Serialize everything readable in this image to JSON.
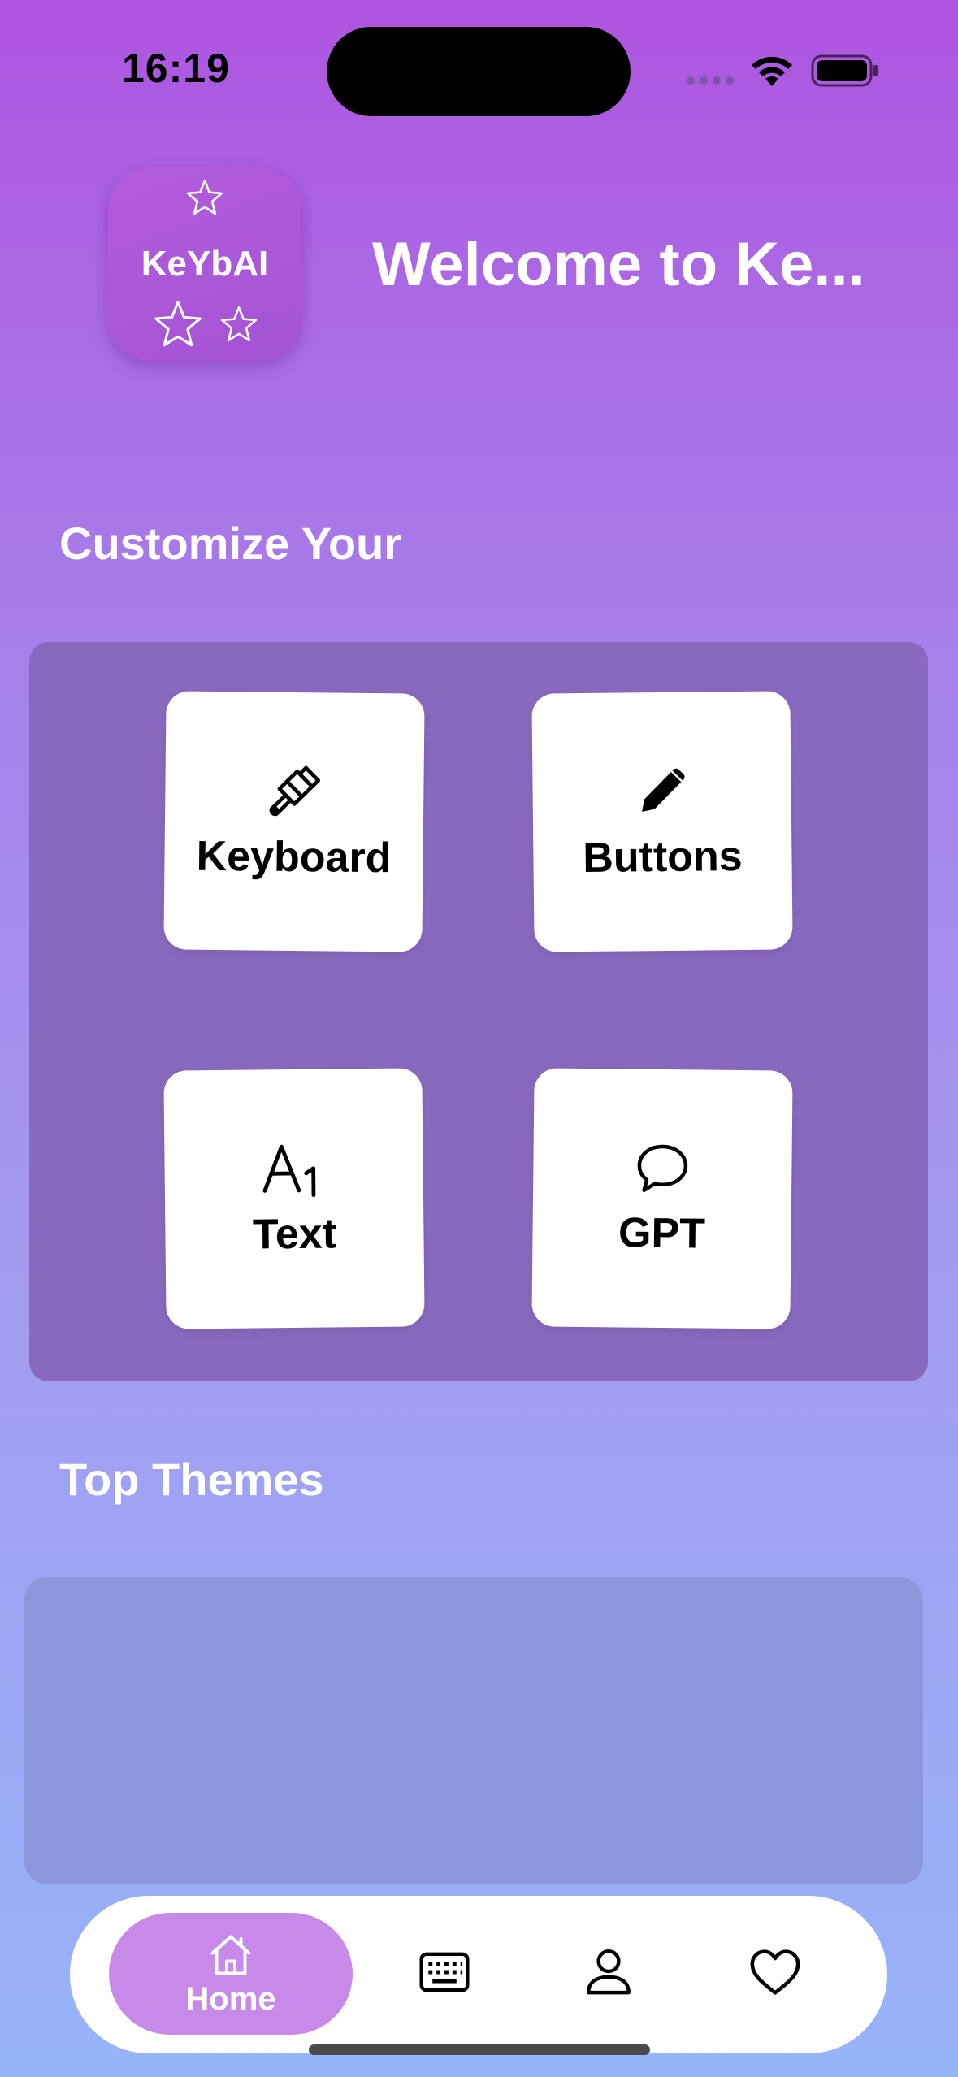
{
  "status_bar": {
    "time": "16:19"
  },
  "header": {
    "logo_text": "KeYbAI",
    "welcome": "Welcome to Ke..."
  },
  "customize": {
    "title": "Customize Your",
    "cards": [
      {
        "label": "Keyboard",
        "icon": "paintbrush-icon"
      },
      {
        "label": "Buttons",
        "icon": "pencil-icon"
      },
      {
        "label": "Text",
        "icon": "text-format-icon"
      },
      {
        "label": "GPT",
        "icon": "chat-bubble-icon"
      }
    ]
  },
  "themes": {
    "title": "Top Themes"
  },
  "tab_bar": {
    "items": [
      {
        "label": "Home",
        "icon": "house-icon",
        "selected": true
      },
      {
        "label": "",
        "icon": "keyboard-icon"
      },
      {
        "label": "",
        "icon": "person-icon"
      },
      {
        "label": "",
        "icon": "heart-icon"
      }
    ]
  },
  "colors": {
    "gradient_top": "#AE55E0",
    "gradient_bottom": "#97B4FA",
    "panel": "#8869BE",
    "home_pill": "#C88AE8"
  }
}
